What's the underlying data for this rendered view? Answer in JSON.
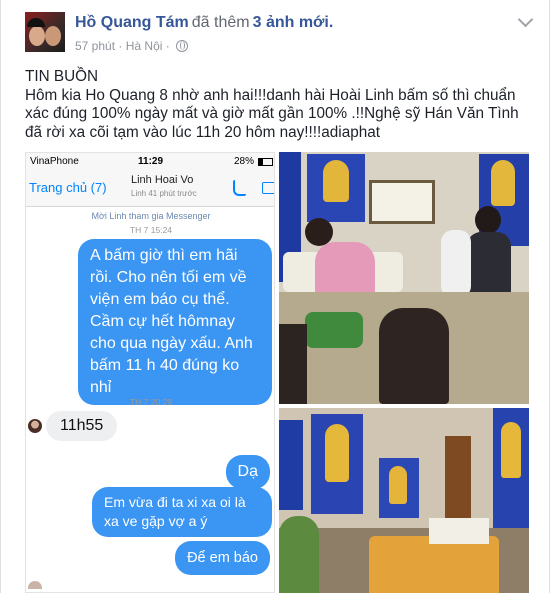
{
  "post": {
    "author": "Hồ Quang Tám",
    "action": "đã thêm",
    "photo_count": "3 ảnh mới.",
    "time": "57 phút",
    "separator": "·",
    "location": "Hà Nội",
    "separator2": "·",
    "privacy_icon": "globe-icon",
    "menu_icon": "chevron-down-icon",
    "text": [
      "TIN BUỒN",
      "Hôm kia Ho Quang 8 nhờ anh hai!!!danh hài Hoài Linh bấm số thì chuẩn xác đúng 100% ngày mất và giờ mất gần 100% .!!Nghệ sỹ Hán Văn Tình đã rời xa cõi tạm vào lúc 11h 20 hôm nay!!!!adiaphat"
    ]
  },
  "screenshot": {
    "status_bar": {
      "carrier": "VinaPhone",
      "time": "11:29",
      "battery": "28%"
    },
    "nav": {
      "back_label": "Trang chủ (7)",
      "contact_name": "Linh Hoai Vo",
      "contact_status": "Linh 41 phút trước"
    },
    "invite": "Mời Linh tham gia Messenger",
    "timestamps": [
      "TH 7 15:24",
      "TH 7 20:29"
    ],
    "messages": [
      {
        "dir": "out",
        "text": "A bấm giờ thì em hãi rồi. Cho nên tối em về viện em báo cụ thể.  Cầm cự hết hômnay cho qua ngày xấu. Anh bấm 11 h 40 đúng ko nhỉ"
      },
      {
        "dir": "in",
        "text": "11h55"
      },
      {
        "dir": "out",
        "text": "Dạ"
      },
      {
        "dir": "out",
        "text": "Em vừa đi ta xi xa oi là xa ve gặp vợ a ý"
      },
      {
        "dir": "out",
        "text": "Để em báo"
      }
    ],
    "colors": {
      "outgoing_bubble": "#3a95f3",
      "incoming_bubble": "#eeeff1",
      "accent": "#0084ff"
    }
  },
  "colors": {
    "link": "#365899",
    "meta": "#90949c",
    "text": "#1d2129"
  }
}
